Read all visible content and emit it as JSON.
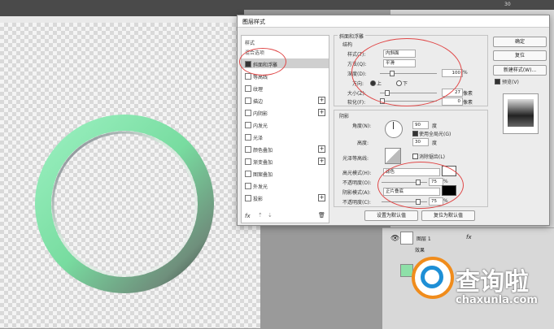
{
  "dialog": {
    "title": "图层样式",
    "close_glyph": "✕",
    "left_list": {
      "header": "样式",
      "blend_options": "混合选项",
      "items": [
        {
          "label": "斜面和浮雕",
          "checked": true,
          "selected": true,
          "plus": false
        },
        {
          "label": "等高线",
          "checked": false,
          "plus": false
        },
        {
          "label": "纹理",
          "checked": false,
          "plus": false
        },
        {
          "label": "描边",
          "checked": false,
          "plus": true
        },
        {
          "label": "内阴影",
          "checked": false,
          "plus": true
        },
        {
          "label": "内发光",
          "checked": false,
          "plus": false
        },
        {
          "label": "光泽",
          "checked": false,
          "plus": false
        },
        {
          "label": "颜色叠加",
          "checked": false,
          "plus": true
        },
        {
          "label": "渐变叠加",
          "checked": false,
          "plus": true
        },
        {
          "label": "图案叠加",
          "checked": false,
          "plus": false
        },
        {
          "label": "外发光",
          "checked": false,
          "plus": false
        },
        {
          "label": "投影",
          "checked": false,
          "plus": true
        }
      ],
      "fx_label": "fx",
      "up_arrow": "⇡",
      "down_arrow": "⇣",
      "trash_icon": "🗑"
    },
    "bevel": {
      "section_title": "斜面和浮雕",
      "structure_title": "结构",
      "style_label": "样式(T):",
      "style_value": "内斜面",
      "technique_label": "方法(Q):",
      "technique_value": "平滑",
      "depth_label": "深度(D):",
      "depth_value": "100",
      "depth_unit": "%",
      "direction_label": "方向:",
      "dir_up": "上",
      "dir_down": "下",
      "size_label": "大小(Z):",
      "size_value": "27",
      "size_unit": "像素",
      "soften_label": "软化(F):",
      "soften_value": "0",
      "soften_unit": "像素"
    },
    "shading": {
      "title": "阴影",
      "angle_label": "角度(N):",
      "angle_value": "90",
      "angle_unit": "度",
      "global_light": "使用全局光(G)",
      "altitude_label": "高度:",
      "altitude_value": "30",
      "altitude_unit": "度",
      "gloss_label": "光泽等高线:",
      "antialias": "消除锯齿(L)",
      "highlight_label": "高光模式(H):",
      "highlight_value": "滤色",
      "opacity1_label": "不透明度(O):",
      "opacity1_value": "75",
      "opacity_unit": "%",
      "shadow_label": "阴影模式(A):",
      "shadow_value": "正片叠底",
      "opacity2_label": "不透明度(C):",
      "opacity2_value": "75"
    },
    "btn_default_set": "设置为默认值",
    "btn_default_reset": "复位为默认值",
    "right": {
      "ok": "确定",
      "reset": "复位",
      "new_style": "新建样式(W)...",
      "preview": "预览(V)"
    }
  },
  "topbar": {
    "zoom": "30"
  },
  "layers": {
    "layer_name": "图层 1",
    "fx": "fx",
    "effects": "效果",
    "eye_icon": "👁"
  },
  "watermark": {
    "brand": "查询啦",
    "url": "chaxunla.com"
  },
  "colors": {
    "ring_green": "#7fe0a6",
    "highlight_swatch": "#ffffff",
    "shadow_swatch": "#000000",
    "annotation_red": "#e04848"
  }
}
